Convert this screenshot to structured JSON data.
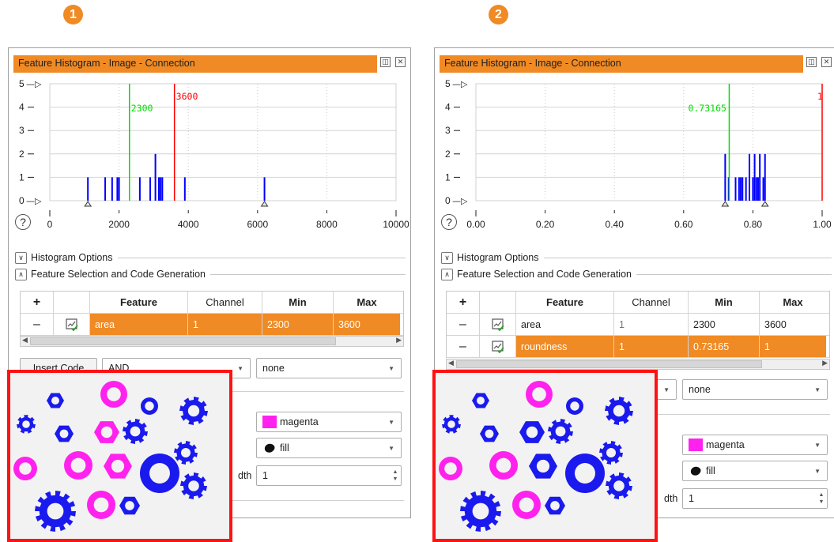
{
  "panels": [
    {
      "badge": "1",
      "title": "Feature Histogram - Image - Connection",
      "histogram": {
        "y_ticks": [
          "0",
          "1",
          "2",
          "3",
          "4",
          "5"
        ],
        "x_ticks": [
          "0",
          "2000",
          "4000",
          "6000",
          "8000",
          "10000"
        ],
        "x_max": 10000,
        "min_value": 2300,
        "max_value": 3600,
        "min_label": "2300",
        "max_label": "3600",
        "bars": [
          1100,
          1600,
          1800,
          1950,
          2000,
          2600,
          2900,
          3050,
          3150,
          3200,
          3250,
          3900,
          6200
        ],
        "bar_counts": [
          1,
          1,
          1,
          1,
          1,
          1,
          1,
          2,
          1,
          1,
          1,
          1,
          1
        ]
      },
      "sections": {
        "options": "Histogram Options",
        "selection": "Feature Selection and Code Generation"
      },
      "table": {
        "columns": [
          "",
          "",
          "Feature",
          "Channel",
          "Min",
          "Max"
        ],
        "rows": [
          {
            "feature": "area",
            "channel": "1",
            "min": "2300",
            "max": "3600",
            "selected": true
          }
        ]
      },
      "insert_code": "Insert Code",
      "operator": "AND",
      "mode": "none",
      "color": "magenta",
      "draw": "fill",
      "line_width_label": "dth",
      "line_width": "1"
    },
    {
      "badge": "2",
      "title": "Feature Histogram - Image - Connection",
      "histogram": {
        "y_ticks": [
          "0",
          "1",
          "2",
          "3",
          "4",
          "5"
        ],
        "x_ticks": [
          "0.00",
          "0.20",
          "0.40",
          "0.60",
          "0.80",
          "1.00"
        ],
        "x_max": 1,
        "min_value": 0.73165,
        "max_value": 1,
        "min_label": "0.73165",
        "max_label": "1",
        "bars": [
          0.72,
          0.73,
          0.75,
          0.76,
          0.765,
          0.77,
          0.78,
          0.79,
          0.8,
          0.805,
          0.81,
          0.815,
          0.82,
          0.83,
          0.835
        ],
        "bar_counts": [
          2,
          1,
          1,
          1,
          1,
          1,
          1,
          2,
          1,
          2,
          1,
          1,
          2,
          1,
          2
        ]
      },
      "sections": {
        "options": "Histogram Options",
        "selection": "Feature Selection and Code Generation"
      },
      "table": {
        "columns": [
          "",
          "",
          "Feature",
          "Channel",
          "Min",
          "Max"
        ],
        "rows": [
          {
            "feature": "area",
            "channel": "1",
            "min": "2300",
            "max": "3600",
            "selected": false
          },
          {
            "feature": "roundness",
            "channel": "1",
            "min": "0.73165",
            "max": "1",
            "selected": true
          }
        ]
      },
      "mode": "none",
      "color": "magenta",
      "draw": "fill",
      "line_width_label": "dth",
      "line_width": "1"
    }
  ],
  "icons": {
    "add": "plus-icon",
    "remove": "minus-icon",
    "feature": "feature-check-icon",
    "help": "help-icon",
    "fill": "fill-blob-icon",
    "float": "float-window-icon",
    "close": "close-icon"
  },
  "colors": {
    "accent": "#f08a24",
    "bar": "#0000ff",
    "min_line": "#00dd00",
    "max_line": "#ff0000",
    "highlight_frame": "#ff1212",
    "selected_shape": "#ff22ee",
    "shape": "#1a1aee"
  }
}
